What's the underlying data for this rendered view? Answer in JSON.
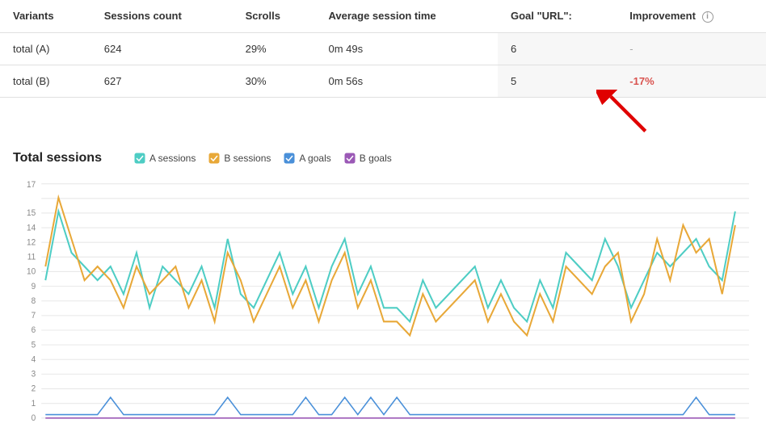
{
  "table": {
    "headers": {
      "variants": "Variants",
      "sessions_count": "Sessions count",
      "scrolls": "Scrolls",
      "avg_session_time": "Average session time",
      "goal_url": "Goal \"URL\":",
      "improvement": "Improvement"
    },
    "rows": [
      {
        "variant": "total (A)",
        "sessions_count": "624",
        "scrolls": "29%",
        "avg_session_time": "0m 49s",
        "goal_url": "6",
        "improvement": "-",
        "improvement_type": "dash"
      },
      {
        "variant": "total (B)",
        "sessions_count": "627",
        "scrolls": "30%",
        "avg_session_time": "0m 56s",
        "goal_url": "5",
        "improvement": "-17%",
        "improvement_type": "negative"
      }
    ]
  },
  "chart": {
    "title": "Total sessions",
    "legend": [
      {
        "label": "A sessions",
        "color": "#4ecdc4",
        "type": "checkbox"
      },
      {
        "label": "B sessions",
        "color": "#e8a838",
        "type": "checkbox"
      },
      {
        "label": "A goals",
        "color": "#4a90d9",
        "type": "checkbox"
      },
      {
        "label": "B goals",
        "color": "#9b59b6",
        "type": "checkbox"
      }
    ],
    "y_axis": [
      "17",
      "15",
      "14",
      "12",
      "11",
      "10",
      "9",
      "8",
      "7",
      "6",
      "5",
      "4",
      "3",
      "2",
      "1",
      "0"
    ],
    "y_labels": [
      17,
      15,
      14,
      12,
      11,
      10,
      9,
      8,
      7,
      6,
      5,
      4,
      3,
      2,
      1,
      0
    ],
    "colors": {
      "a_sessions": "#4ecdc4",
      "b_sessions": "#e8a838",
      "a_goals": "#4a90d9",
      "b_goals": "#9b59b6"
    }
  }
}
